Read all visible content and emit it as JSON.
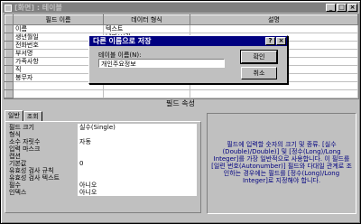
{
  "window": {
    "title": "[화면] : 테이블",
    "controls": [
      "_",
      "□",
      "×"
    ]
  },
  "grid": {
    "columns": [
      "필드 이름",
      "데이터 형식",
      "설명"
    ],
    "rows": [
      {
        "name": "이름",
        "type": "텍스트"
      },
      {
        "name": "생년월일",
        "type": "날짜/시간"
      },
      {
        "name": "전화번호",
        "type": "텍"
      },
      {
        "name": "부서명",
        "type": "텍"
      },
      {
        "name": "가족사항",
        "type": "텍스트"
      },
      {
        "name": "직",
        "type": "숫"
      },
      {
        "name": "봉무자",
        "type": "숫"
      }
    ]
  },
  "field_properties_label": "필드 속성",
  "tabs": [
    "일반",
    "조회"
  ],
  "properties": [
    {
      "label": "필드 크기",
      "value": "실수(Single)"
    },
    {
      "label": "형식",
      "value": ""
    },
    {
      "label": "소수 자릿수",
      "value": "자동"
    },
    {
      "label": "입력 마스크",
      "value": ""
    },
    {
      "label": "캡션",
      "value": ""
    },
    {
      "label": "기본값",
      "value": "0"
    },
    {
      "label": "유효성 검사 규칙",
      "value": ""
    },
    {
      "label": "유효성 검사 텍스트",
      "value": ""
    },
    {
      "label": "필수",
      "value": "아니오"
    },
    {
      "label": "인덱스",
      "value": "아니오"
    }
  ],
  "help_text": "필드에 입력할 숫자의 크기 및 종류. [실수(Double)/Double)] 및 [정수(Long)/Long Integer]를 가장 일반적으로 사용합니다. 이 필드를 [일련 번호(Autonumber)] 필드와 다대일 관계로 조인하는 경우에는 필드를 [정수(Long)/Long Integer]로 지정해야 합니다.",
  "dialog": {
    "title": "다른 이름으로 저장",
    "controls": [
      "?",
      "×"
    ],
    "label": "테이블 이름(N):",
    "input_value": "개인주요정보",
    "ok_label": "확인",
    "cancel_label": "취소"
  }
}
